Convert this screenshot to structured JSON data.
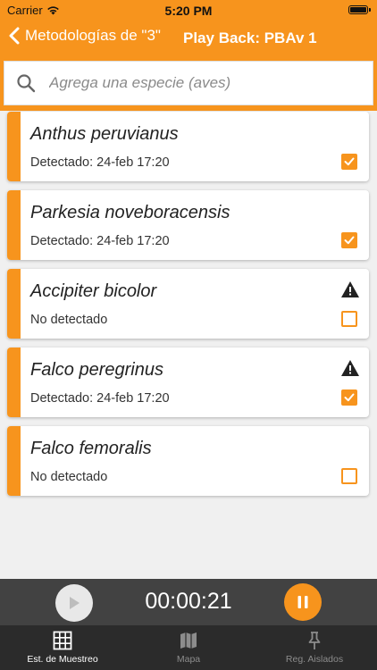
{
  "status_bar": {
    "carrier": "Carrier",
    "time": "5:20 PM"
  },
  "nav": {
    "back_label": "Metodologías de \"3\"",
    "title": "Play Back: PBAv 1"
  },
  "search": {
    "placeholder": "Agrega una especie (aves)",
    "value": ""
  },
  "species": [
    {
      "name": "Anthus peruvianus",
      "status": "Detectado: 24-feb 17:20",
      "checked": true,
      "warning": false
    },
    {
      "name": "Parkesia noveboracensis",
      "status": "Detectado: 24-feb 17:20",
      "checked": true,
      "warning": false
    },
    {
      "name": "Accipiter bicolor",
      "status": "No detectado",
      "checked": false,
      "warning": true
    },
    {
      "name": "Falco peregrinus",
      "status": "Detectado: 24-feb 17:20",
      "checked": true,
      "warning": true
    },
    {
      "name": "Falco femoralis",
      "status": "No detectado",
      "checked": false,
      "warning": false
    }
  ],
  "player": {
    "timer": "00:00:21"
  },
  "tabs": [
    {
      "label": "Est. de Muestreo",
      "icon": "grid-icon",
      "active": true
    },
    {
      "label": "Mapa",
      "icon": "map-icon",
      "active": false
    },
    {
      "label": "Reg. Aislados",
      "icon": "pin-icon",
      "active": false
    }
  ],
  "colors": {
    "accent": "#f7941d",
    "player_bg": "#424242",
    "tabbar_bg": "#2b2b2b"
  }
}
